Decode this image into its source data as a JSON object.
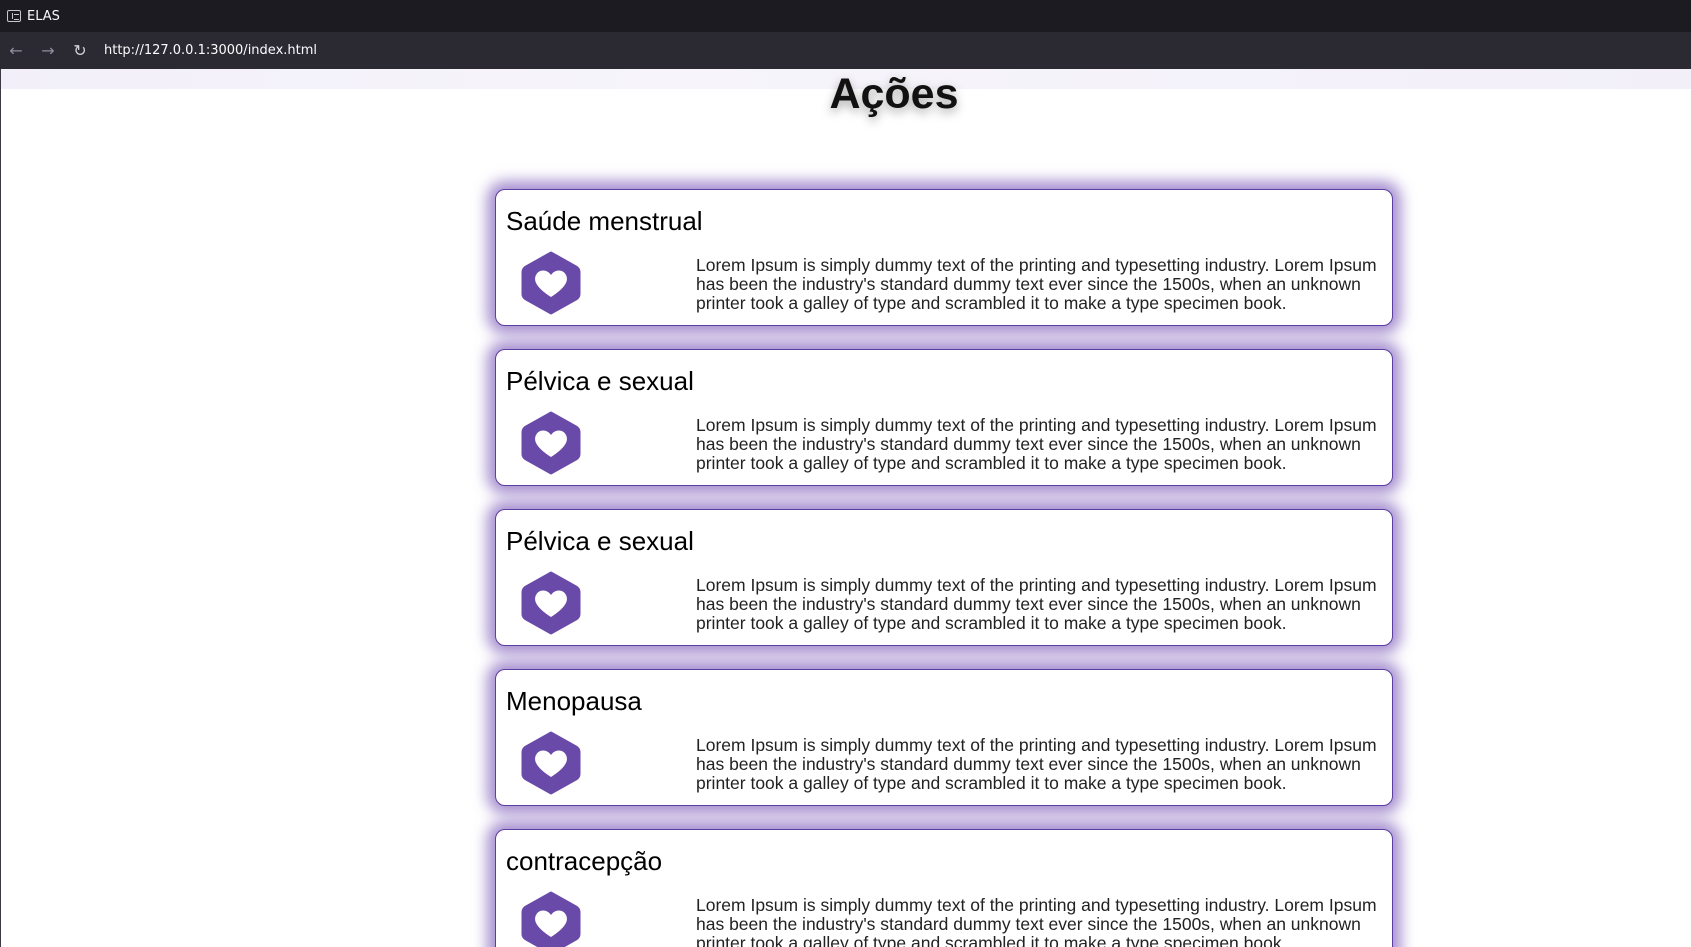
{
  "browser": {
    "tab_title": "ELAS",
    "url": "http://127.0.0.1:3000/index.html",
    "back_icon": "←",
    "forward_icon": "→",
    "reload_icon": "↻"
  },
  "page": {
    "title": "Ações",
    "colors": {
      "accent": "#6a4aa8",
      "card_border": "#5b3ea0",
      "card_glow": "#9c84cc"
    }
  },
  "cards": [
    {
      "title": "Saúde menstrual",
      "icon": "heart-hexagon-icon",
      "text": "Lorem Ipsum is simply dummy text of the printing and typesetting industry. Lorem Ipsum has been the industry's standard dummy text ever since the 1500s, when an unknown printer took a galley of type and scrambled it to make a type specimen book."
    },
    {
      "title": "Pélvica e sexual",
      "icon": "heart-hexagon-icon",
      "text": "Lorem Ipsum is simply dummy text of the printing and typesetting industry. Lorem Ipsum has been the industry's standard dummy text ever since the 1500s, when an unknown printer took a galley of type and scrambled it to make a type specimen book."
    },
    {
      "title": "Pélvica e sexual",
      "icon": "heart-hexagon-icon",
      "text": "Lorem Ipsum is simply dummy text of the printing and typesetting industry. Lorem Ipsum has been the industry's standard dummy text ever since the 1500s, when an unknown printer took a galley of type and scrambled it to make a type specimen book."
    },
    {
      "title": "Menopausa",
      "icon": "heart-hexagon-icon",
      "text": "Lorem Ipsum is simply dummy text of the printing and typesetting industry. Lorem Ipsum has been the industry's standard dummy text ever since the 1500s, when an unknown printer took a galley of type and scrambled it to make a type specimen book."
    },
    {
      "title": "contracepção",
      "icon": "heart-hexagon-icon",
      "text": "Lorem Ipsum is simply dummy text of the printing and typesetting industry. Lorem Ipsum has been the industry's standard dummy text ever since the 1500s, when an unknown printer took a galley of type and scrambled it to make a type specimen book."
    }
  ]
}
